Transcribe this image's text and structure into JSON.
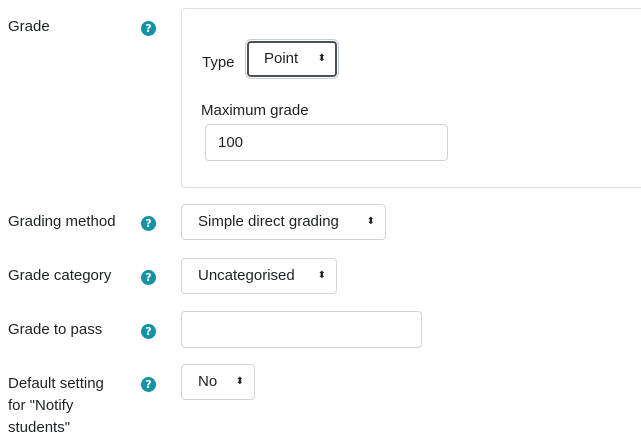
{
  "help_icon_glyph": "?",
  "colors": {
    "help_icon": "#1493a4",
    "text": "#1d2125",
    "border": "#ced4da"
  },
  "grade": {
    "label": "Grade",
    "type_label": "Type",
    "type_value": "Point",
    "max_grade_label": "Maximum grade",
    "max_grade_value": "100"
  },
  "grading_method": {
    "label": "Grading method",
    "value": "Simple direct grading"
  },
  "grade_category": {
    "label": "Grade category",
    "value": "Uncategorised"
  },
  "grade_to_pass": {
    "label": "Grade to pass",
    "value": ""
  },
  "notify_students": {
    "label_line1": "Default setting",
    "label_line2": "for \"Notify",
    "label_line3": "students\"",
    "value": "No"
  },
  "caret_glyph": "⬍"
}
